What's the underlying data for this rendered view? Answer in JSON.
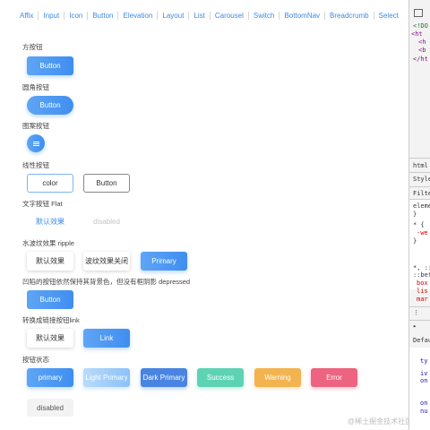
{
  "nav": [
    "Affix",
    "Input",
    "Icon",
    "Button",
    "Elevation",
    "Layout",
    "List",
    "Carousel",
    "Switch",
    "BottomNav",
    "Breadcrumb",
    "Select"
  ],
  "sections": {
    "square": {
      "label": "方按钮",
      "button": "Button"
    },
    "rounded": {
      "label": "圆角按钮",
      "button": "Button"
    },
    "icon": {
      "label": "图案按钮",
      "icon": "menu-icon"
    },
    "outline": {
      "label": "线性按钮",
      "color_button": "color",
      "button": "Button"
    },
    "flat": {
      "label": "文字按钮 Flat",
      "default": "默认效果",
      "disabled": "disabled"
    },
    "ripple": {
      "label": "水波纹效果 ripple",
      "default": "默认效果",
      "off": "波纹效果关闭",
      "primary": "Primary"
    },
    "depressed": {
      "label": "凹陷的按钮依然保持其背景色，但没有框阴影 depressed",
      "button": "Button"
    },
    "link": {
      "label": "转换成链接按钮link",
      "default": "默认效果",
      "link": "Link"
    },
    "states": {
      "label": "按钮状态",
      "primary": "primary",
      "light": "Light Primary",
      "dark": "Dark Primary",
      "success": "Success",
      "warning": "Warning",
      "error": "Error",
      "disabled": "disabled"
    }
  },
  "watermark": "@稀土掘金技术社区",
  "devtools": {
    "line1": "<!DO",
    "line2": "<ht",
    "line3": "<h",
    "line4": "<b",
    "line5": "</ht",
    "tab": "html",
    "styles": "Styles",
    "filter": "Filter",
    "element": "eleme",
    "brace1": "}",
    "star1": "* {",
    "webkit": "-we",
    "brace2": "}",
    "star2": "*, ::",
    "before": "::bef",
    "box": "box",
    "list": "lis",
    "margin": "mar",
    "default": "Defau",
    "ty": "ty",
    "iv": "iv",
    "on1": "on",
    "on2": "on",
    "nu": "nu"
  },
  "colors": {
    "primary": "#3f8ef0",
    "light_primary": "#8cc2f7",
    "dark_primary": "#4a84e2",
    "success": "#5ed3b3",
    "warning": "#f3b34e",
    "error": "#ec6480",
    "nav_link": "#3b8ae6"
  }
}
